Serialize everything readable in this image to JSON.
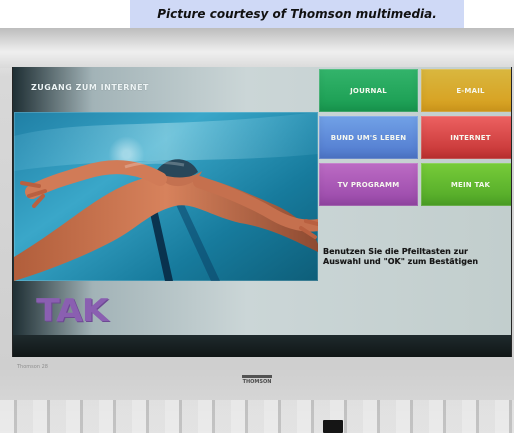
{
  "caption": "Picture courtesy of Thomson multimedia.",
  "portal": {
    "title": "ZUGANG ZUM INTERNET",
    "menu_items": [
      {
        "label": "JOURNAL",
        "color": "#189b50"
      },
      {
        "label": "E-MAIL",
        "color": "#d79d1c"
      },
      {
        "label": "BUND UM'S LEBEN",
        "color": "#4f78cd"
      },
      {
        "label": "INTERNET",
        "color": "#c23131"
      },
      {
        "label": "TV PROGRAMM",
        "color": "#9747a8"
      },
      {
        "label": "MEIN TAK",
        "color": "#4ea526"
      }
    ],
    "instruction": "Benutzen Sie die Pfeiltasten zur Auswahl und \"OK\" zum Bestätigen",
    "logo": "TAK"
  },
  "device": {
    "small_label": "Thomson 28",
    "brand_logo": "THOMSON"
  },
  "colors": {
    "caption_background": "#cfd9f6",
    "screen_background": "#cbd6d7",
    "tak_logo": "#8a5fb1"
  },
  "icons": {
    "video": "swimmer-image"
  }
}
